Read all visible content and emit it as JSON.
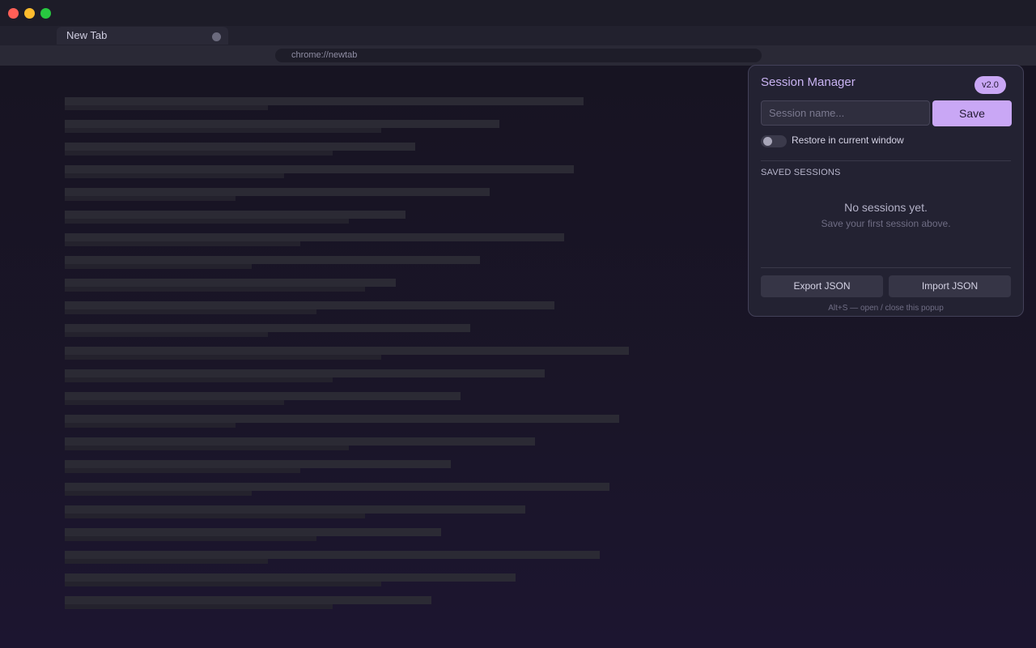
{
  "browser": {
    "tab": {
      "title": "New Tab"
    },
    "address": {
      "url": "chrome://newtab"
    }
  },
  "popup": {
    "title": "Session Manager",
    "version": "v2.0",
    "input_placeholder": "Session name...",
    "save_label": "Save",
    "toggle": {
      "label": "Restore in current window",
      "on": false
    },
    "section_label": "SAVED SESSIONS",
    "empty": {
      "title": "No sessions yet.",
      "subtitle": "Save your first session above."
    },
    "export_label": "Export JSON",
    "import_label": "Import JSON",
    "hint": "Alt+S — open / close this popup"
  },
  "colors": {
    "accent": "#c9a7f5",
    "popup_bg": "#232232",
    "page_bg": "#1c1729"
  }
}
